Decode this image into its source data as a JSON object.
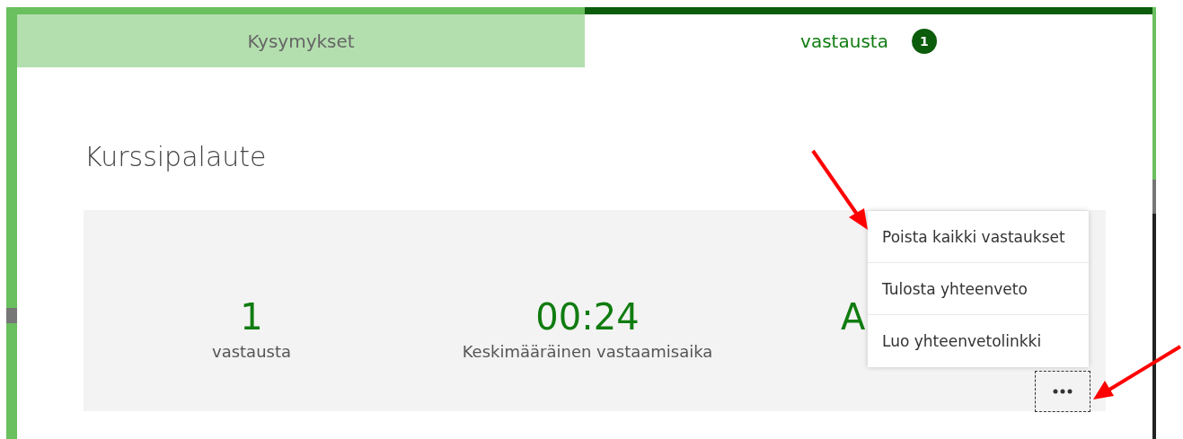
{
  "tabs": [
    {
      "label": "Kysymykset",
      "selected": false
    },
    {
      "label": "vastausta",
      "selected": true,
      "badge": "1"
    }
  ],
  "form_title": "Kurssipalaute",
  "stats": [
    {
      "value": "1",
      "label": "vastausta"
    },
    {
      "value": "00:24",
      "label": "Keskimääräinen vastaamisaika"
    },
    {
      "value": "A"
    }
  ],
  "menu": {
    "items": [
      {
        "label": "Poista kaikki vastaukset"
      },
      {
        "label": "Tulosta yhteenveto"
      },
      {
        "label": "Luo yhteenvetolinkki"
      }
    ]
  }
}
